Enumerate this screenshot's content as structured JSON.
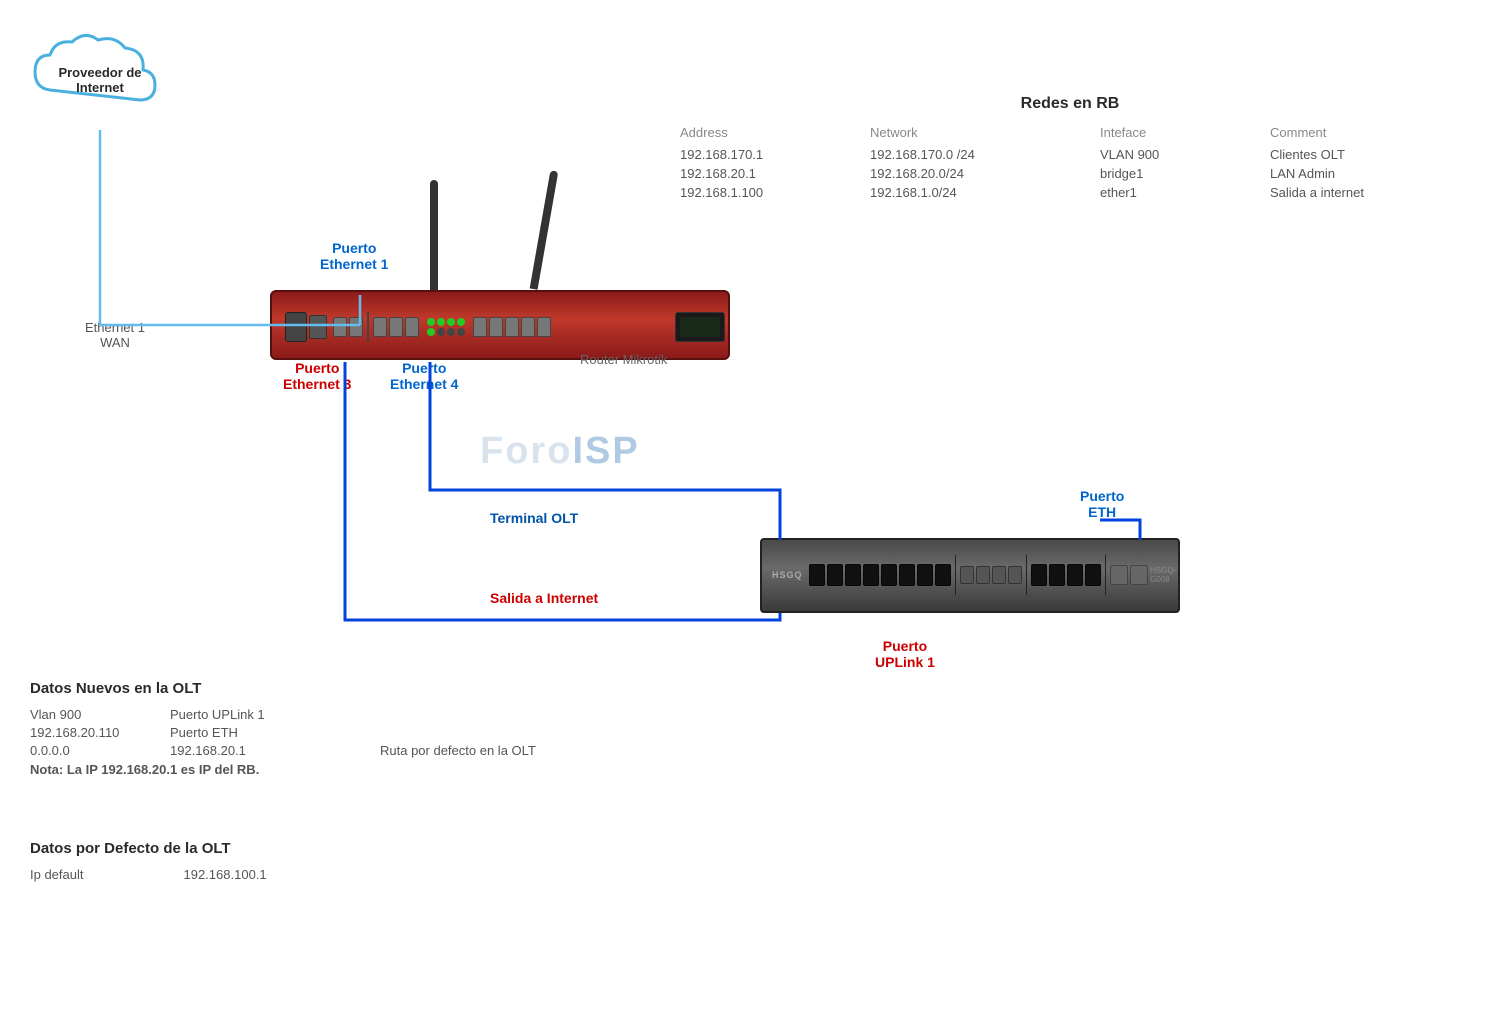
{
  "cloud": {
    "label": "Proveedor de\nInternet"
  },
  "network_table": {
    "title": "Redes en RB",
    "headers": [
      "Address",
      "Network",
      "Inteface",
      "Comment"
    ],
    "rows": [
      [
        "192.168.170.1",
        "192.168.170.0 /24",
        "VLAN 900",
        "Clientes OLT"
      ],
      [
        "192.168.20.1",
        "192.168.20.0/24",
        "bridge1",
        "LAN Admin"
      ],
      [
        "192.168.1.100",
        "192.168.1.0/24",
        "ether1",
        "Salida a internet"
      ]
    ]
  },
  "labels": {
    "eth1_wan_line1": "Ethernet 1",
    "eth1_wan_line2": "WAN",
    "puerto_eth1_line1": "Puerto",
    "puerto_eth1_line2": "Ethernet 1",
    "puerto_eth3_line1": "Puerto",
    "puerto_eth3_line2": "Ethernet 3",
    "puerto_eth4_line1": "Puerto",
    "puerto_eth4_line2": "Ethernet 4",
    "router_label": "Router Mikrotik",
    "terminal_olt": "Terminal OLT",
    "salida_internet": "Salida a Internet",
    "puerto_eth_line1": "Puerto",
    "puerto_eth_line2": "ETH",
    "puerto_uplink_line1": "Puerto",
    "puerto_uplink_line2": "UPLink 1",
    "watermark": "ForoISP"
  },
  "datos_nuevos": {
    "title": "Datos Nuevos en  la OLT",
    "rows": [
      [
        "Vlan 900",
        "Puerto UPLink 1",
        ""
      ],
      [
        "192.168.20.110",
        "Puerto ETH",
        ""
      ],
      [
        "0.0.0.0",
        "192.168.20.1",
        "Ruta  por defecto en la OLT"
      ],
      [
        "Nota: La IP 192.168.20.1 es IP del RB.",
        "",
        ""
      ]
    ]
  },
  "datos_defecto": {
    "title": "Datos por Defecto de la OLT",
    "row": {
      "label": "Ip default",
      "value": "192.168.100.1"
    }
  }
}
